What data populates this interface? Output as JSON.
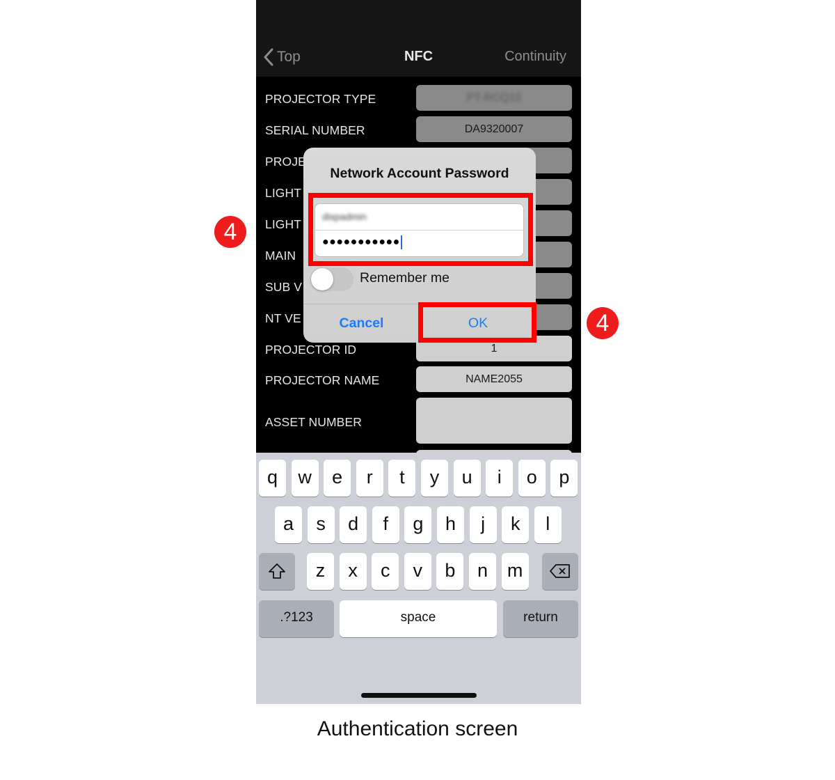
{
  "navbar": {
    "back_label": "Top",
    "title": "NFC",
    "right_label": "Continuity"
  },
  "fields": [
    {
      "label": "PROJECTOR TYPE",
      "value": "PT-RCQ10",
      "blurred": true
    },
    {
      "label": "SERIAL NUMBER",
      "value": "DA9320007"
    },
    {
      "label": "PROJECTOR",
      "value": ""
    },
    {
      "label": "LIGHT",
      "value": ""
    },
    {
      "label": "LIGHT",
      "value": ""
    },
    {
      "label": "MAIN",
      "value": ""
    },
    {
      "label": "SUB V",
      "value": ""
    },
    {
      "label": "NT VE",
      "value": ""
    },
    {
      "label": "PROJECTOR ID",
      "value": "1"
    },
    {
      "label": "PROJECTOR NAME",
      "value": "NAME2055"
    },
    {
      "label": "ASSET NUMBER",
      "value": ""
    }
  ],
  "dialog": {
    "title": "Network Account Password",
    "username_value": "dispadmin",
    "password_masked": "●●●●●●●●●●●",
    "remember_label": "Remember me",
    "remember_on": false,
    "cancel_label": "Cancel",
    "ok_label": "OK"
  },
  "annotations": {
    "step_badge_left": "4",
    "step_badge_right": "4",
    "highlight_color": "#ff0000"
  },
  "keyboard": {
    "row1": [
      "q",
      "w",
      "e",
      "r",
      "t",
      "y",
      "u",
      "i",
      "o",
      "p"
    ],
    "row2": [
      "a",
      "s",
      "d",
      "f",
      "g",
      "h",
      "j",
      "k",
      "l"
    ],
    "row3": [
      "z",
      "x",
      "c",
      "v",
      "b",
      "n",
      "m"
    ],
    "shift_icon": "shift-icon",
    "delete_icon": "delete-icon",
    "numbers_label": ".?123",
    "space_label": "space",
    "return_label": "return"
  },
  "caption": "Authentication screen"
}
